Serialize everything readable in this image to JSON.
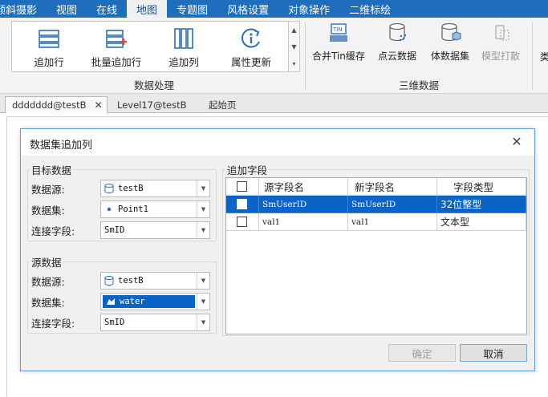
{
  "menu": {
    "items": [
      {
        "label": "倾斜摄影"
      },
      {
        "label": "视图"
      },
      {
        "label": "在线"
      },
      {
        "label": "地图"
      },
      {
        "label": "专题图"
      },
      {
        "label": "风格设置"
      },
      {
        "label": "对象操作"
      },
      {
        "label": "二维标绘"
      }
    ],
    "active_index": 3
  },
  "ribbon": {
    "data_processing": {
      "group_label": "数据处理",
      "add_row": "追加行",
      "batch_add_row": "批量追加行",
      "add_column": "追加列",
      "update_attribute": "属性更新"
    },
    "three_d_data": {
      "group_label": "三维数据",
      "merge_tin_cache": "合并Tin缓存",
      "point_cloud_data": "点云数据",
      "volume_dataset": "体数据集",
      "model_stamp": "模型打散",
      "truncated": "类"
    }
  },
  "doc_tabs": [
    {
      "label": "ddddddd@testB",
      "active": true,
      "closable": true
    },
    {
      "label": "Level17@testB",
      "active": false
    },
    {
      "label": "起始页",
      "active": false
    }
  ],
  "dialog": {
    "title": "数据集追加列",
    "target": {
      "group_title": "目标数据",
      "datasource_label": "数据源:",
      "datasource_value": "testB",
      "dataset_label": "数据集:",
      "dataset_value": "Point1",
      "join_field_label": "连接字段:",
      "join_field_value": "SmID"
    },
    "source": {
      "group_title": "源数据",
      "datasource_label": "数据源:",
      "datasource_value": "testB",
      "dataset_label": "数据集:",
      "dataset_value": "water",
      "join_field_label": "连接字段:",
      "join_field_value": "SmID"
    },
    "append_fields": {
      "group_title": "追加字段",
      "columns": [
        "源字段名",
        "新字段名",
        "字段类型"
      ],
      "rows": [
        {
          "checked": false,
          "source_field": "SmUserID",
          "new_field": "SmUserID",
          "field_type": "32位整型",
          "selected": true
        },
        {
          "checked": false,
          "source_field": "val1",
          "new_field": "val1",
          "field_type": "文本型",
          "selected": false
        }
      ]
    },
    "ok_label": "确定",
    "cancel_label": "取消"
  },
  "colors": {
    "menubar_bg": "#1f6ebd",
    "selection": "#0a64c8",
    "dialog_border": "#5c9bd8"
  }
}
